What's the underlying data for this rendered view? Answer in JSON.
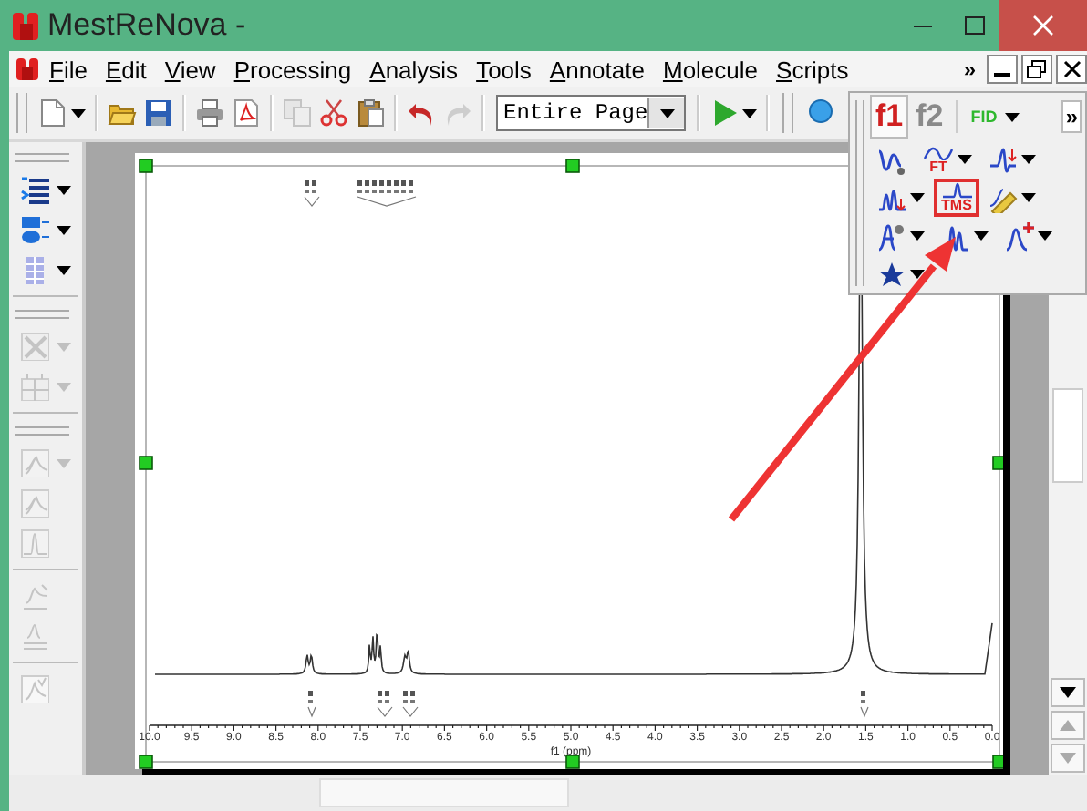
{
  "window": {
    "title": "MestReNova -"
  },
  "menu": [
    {
      "label": "File"
    },
    {
      "label": "Edit"
    },
    {
      "label": "View"
    },
    {
      "label": "Processing"
    },
    {
      "label": "Analysis"
    },
    {
      "label": "Tools"
    },
    {
      "label": "Annotate"
    },
    {
      "label": "Molecule"
    },
    {
      "label": "Scripts"
    }
  ],
  "menu_more": "»",
  "toolbar": [
    {
      "kind": "grip"
    },
    {
      "kind": "new",
      "dropdown": true,
      "disabled": false
    },
    {
      "kind": "separator"
    },
    {
      "kind": "open",
      "dropdown": false,
      "disabled": false
    },
    {
      "kind": "save",
      "dropdown": false,
      "disabled": false
    },
    {
      "kind": "separator"
    },
    {
      "kind": "print",
      "dropdown": false,
      "disabled": false
    },
    {
      "kind": "pdf",
      "dropdown": false,
      "disabled": false
    },
    {
      "kind": "separator"
    },
    {
      "kind": "copy",
      "dropdown": false,
      "disabled": true
    },
    {
      "kind": "cut",
      "dropdown": false,
      "disabled": false
    },
    {
      "kind": "paste",
      "dropdown": false,
      "disabled": false
    },
    {
      "kind": "separator"
    },
    {
      "kind": "undo",
      "dropdown": false,
      "disabled": false
    },
    {
      "kind": "redo",
      "dropdown": false,
      "disabled": true
    },
    {
      "kind": "separator"
    },
    {
      "kind": "select",
      "value": "Entire Page"
    },
    {
      "kind": "separator"
    },
    {
      "kind": "run",
      "dropdown": true,
      "disabled": false
    },
    {
      "kind": "separator"
    },
    {
      "kind": "grip"
    },
    {
      "kind": "search",
      "dropdown": false,
      "disabled": false
    }
  ],
  "side_toolbar": [
    {
      "kind": "grip"
    },
    {
      "kind": "list",
      "dropdown": true,
      "disabled": false
    },
    {
      "kind": "shapes",
      "dropdown": true,
      "disabled": false
    },
    {
      "kind": "grid",
      "dropdown": true,
      "disabled": false
    },
    {
      "kind": "separator"
    },
    {
      "kind": "grip"
    },
    {
      "kind": "cross",
      "dropdown": true,
      "disabled": true
    },
    {
      "kind": "matrix",
      "dropdown": true,
      "disabled": true
    },
    {
      "kind": "separator"
    },
    {
      "kind": "grip"
    },
    {
      "kind": "stack",
      "dropdown": true,
      "disabled": true
    },
    {
      "kind": "stack",
      "dropdown": false,
      "disabled": true
    },
    {
      "kind": "peak",
      "dropdown": false,
      "disabled": true
    },
    {
      "kind": "separator"
    },
    {
      "kind": "fit",
      "dropdown": false,
      "disabled": true
    },
    {
      "kind": "scale",
      "dropdown": false,
      "disabled": true
    },
    {
      "kind": "separator"
    },
    {
      "kind": "check",
      "dropdown": false,
      "disabled": true
    }
  ],
  "float_toolbar": {
    "tabs": [
      {
        "label": "f1",
        "selected": true
      },
      {
        "label": "f2",
        "selected": false
      }
    ],
    "fid_button": "FID",
    "more": "»",
    "rows": [
      [
        {
          "kind": "fid",
          "dropdown": false,
          "highlighted": false
        },
        {
          "kind": "ft",
          "label": "FT",
          "dropdown": true,
          "highlighted": false
        },
        {
          "kind": "phase",
          "dropdown": true,
          "highlighted": false
        }
      ],
      [
        {
          "kind": "baseline",
          "dropdown": true,
          "highlighted": false
        },
        {
          "kind": "tms",
          "label": "TMS",
          "dropdown": false,
          "highlighted": true
        },
        {
          "kind": "pick",
          "dropdown": true,
          "highlighted": false
        }
      ],
      [
        {
          "kind": "multiplet",
          "dropdown": true,
          "highlighted": false
        },
        {
          "kind": "integral",
          "dropdown": true,
          "highlighted": false
        },
        {
          "kind": "fitting",
          "dropdown": true,
          "highlighted": false
        }
      ],
      [
        {
          "kind": "star",
          "dropdown": true,
          "highlighted": false
        }
      ]
    ]
  },
  "spectrum": {
    "tick_labels": [
      "10.0",
      "9.5",
      "9.0",
      "8.5",
      "8.0",
      "7.5",
      "7.0",
      "6.5",
      "6.0",
      "5.5",
      "5.0",
      "4.5",
      "4.0",
      "3.5",
      "3.0",
      "2.5",
      "2.0",
      "1.5",
      "1.0",
      "0.5",
      "0.0"
    ],
    "axis_label": "f1 (ppm)"
  }
}
